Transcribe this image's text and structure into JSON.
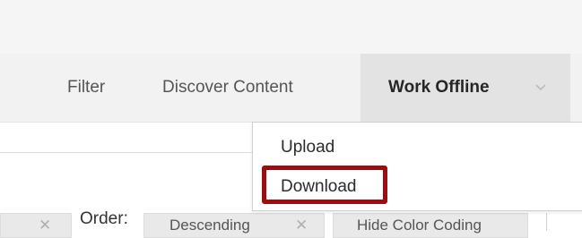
{
  "nav": {
    "filter": "Filter",
    "discover": "Discover Content",
    "work_offline": "Work Offline"
  },
  "icons": {
    "work_offline_chevron": "chevron-down-icon",
    "chip_close": "close-icon"
  },
  "dropdown": {
    "items": [
      {
        "label": "Upload"
      },
      {
        "label": "Download"
      }
    ],
    "highlighted": "Download",
    "highlight_color": "#9e0c0f"
  },
  "toolbar": {
    "order_label": "Order:",
    "descending": "Descending",
    "hide_color": "Hide Color Coding"
  }
}
